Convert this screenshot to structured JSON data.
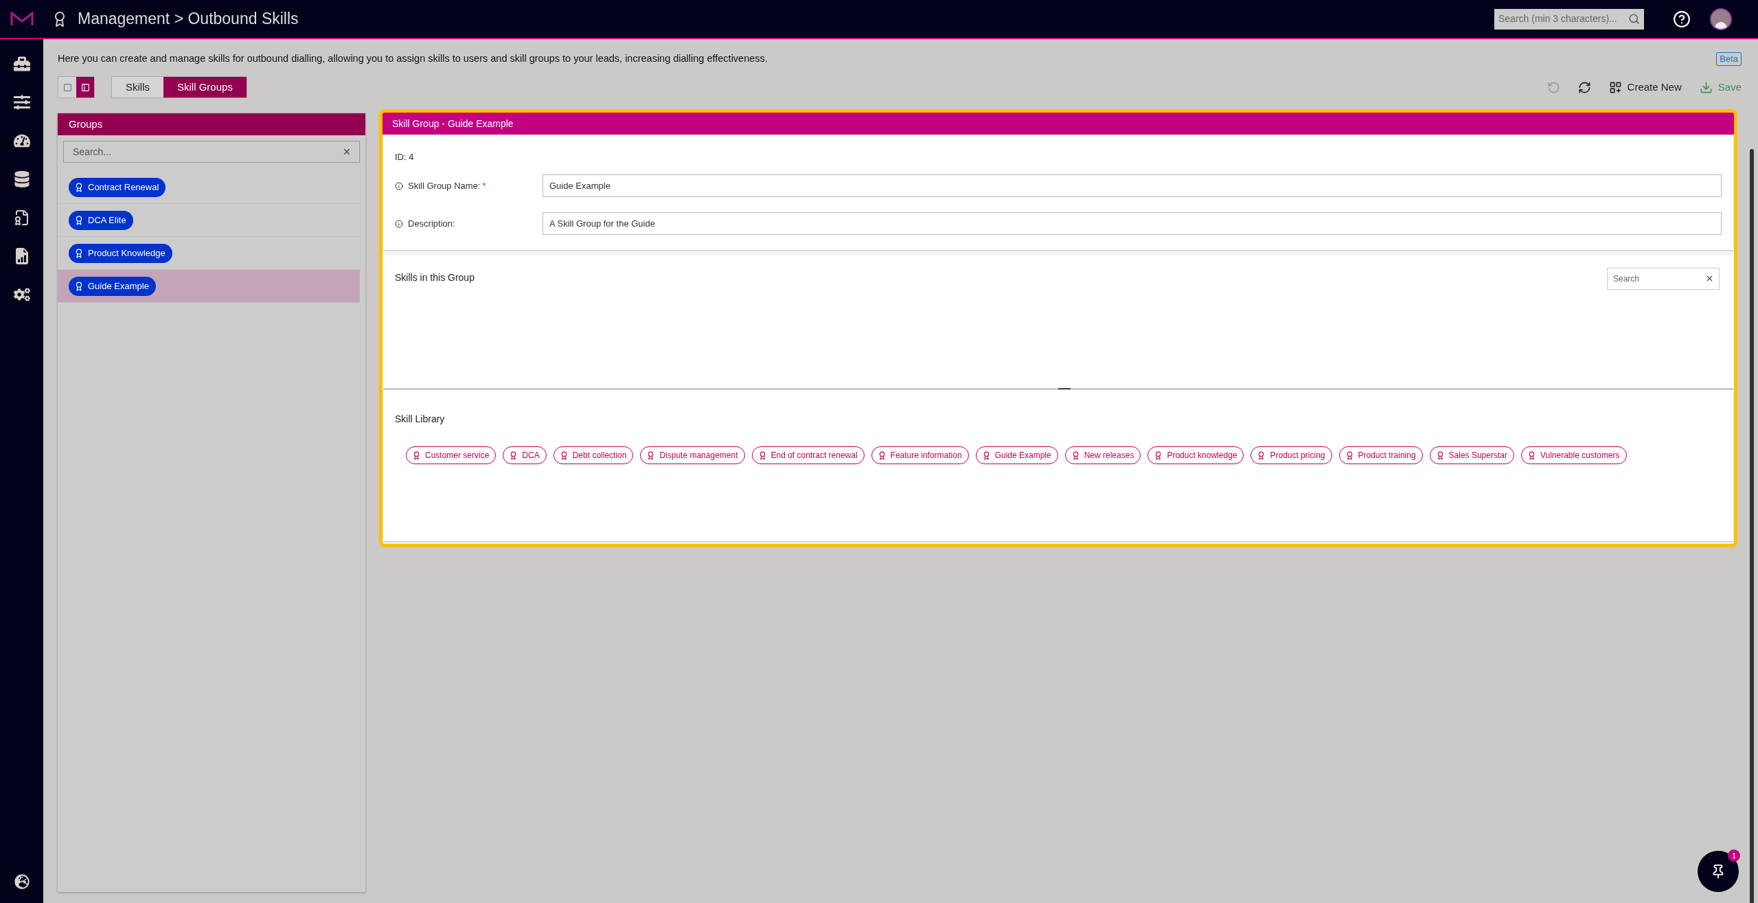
{
  "header": {
    "breadcrumb": "Management > Outbound Skills",
    "search": {
      "placeholder": "Search (min 3 characters)..."
    }
  },
  "intro": "Here you can create and manage skills for outbound dialling, allowing you to assign skills to users and skill groups to your leads, increasing dialling effectiveness.",
  "beta_badge": "Beta",
  "layout_buttons": [
    {
      "kind": "single",
      "selected": false
    },
    {
      "kind": "split",
      "selected": true
    }
  ],
  "tabs": [
    {
      "label": "Skills",
      "selected": false
    },
    {
      "label": "Skill Groups",
      "selected": true
    }
  ],
  "toolbar": [
    {
      "kind": "undo",
      "disabled": true
    },
    {
      "kind": "refresh",
      "disabled": false
    },
    {
      "kind": "create",
      "label": "Create New",
      "disabled": false
    },
    {
      "kind": "save",
      "label": "Save",
      "disabled": true
    }
  ],
  "groups_panel": {
    "title": "Groups",
    "search": {
      "placeholder": "Search..."
    },
    "items": [
      {
        "label": "Contract Renewal",
        "selected": false
      },
      {
        "label": "DCA Elite",
        "selected": false
      },
      {
        "label": "Product Knowledge",
        "selected": false
      },
      {
        "label": "Guide Example",
        "selected": true
      }
    ]
  },
  "detail": {
    "title": "Skill Group - Guide Example",
    "id": "ID: 4",
    "fields": [
      {
        "label": "Skill Group Name:",
        "required_mark": "*",
        "value": "Guide Example"
      },
      {
        "label": "Description:",
        "value": "A Skill Group for the Guide"
      }
    ],
    "skills_in_group": {
      "title": "Skills in this Group",
      "search": {
        "placeholder": "Search"
      }
    },
    "skill_library": {
      "title": "Skill Library",
      "skills": [
        "Customer service",
        "DCA",
        "Debt collection",
        "Dispute management",
        "End of contract renewal",
        "Feature information",
        "Guide Example",
        "New releases",
        "Product knowledge",
        "Product pricing",
        "Product training",
        "Sales Superstar",
        "Vulnerable customers"
      ]
    }
  },
  "pin_button": {
    "badge": "1"
  }
}
